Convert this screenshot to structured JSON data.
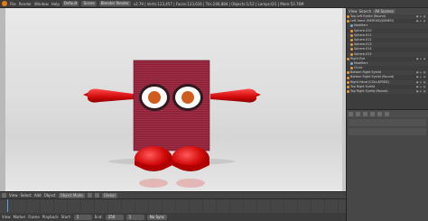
{
  "topbar": {
    "menus": [
      "File",
      "Render",
      "Window",
      "Help"
    ],
    "layout": "Default",
    "scene": "Scene",
    "engine": "Blender Render",
    "stats": "v2.79 | Verts:123,457 | Faces:123,616 | Tris:246,884 | Objects:1/12 | Lamps:0/1 | Mem:53.76M"
  },
  "viewport_header": {
    "items": [
      "View",
      "Select",
      "Add",
      "Object"
    ],
    "mode": "Object Mode",
    "pivot": "Global"
  },
  "timeline": {
    "items": [
      "View",
      "Marker",
      "Frame",
      "Playback"
    ],
    "start_label": "Start:",
    "start": "1",
    "end_label": "End:",
    "end": "250",
    "current": "1",
    "sync": "No Sync"
  },
  "outliner": {
    "view": "View",
    "search": "Search",
    "scope": "All Scenes",
    "rows": [
      {
        "label": "Top Left Eyelid (Round)"
      },
      {
        "label": "Left Hand (MERGED/JOINED)"
      },
      {
        "label": "Modifiers"
      },
      {
        "label": "Sphere.010"
      },
      {
        "label": "Sphere.011"
      },
      {
        "label": "Sphere.012"
      },
      {
        "label": "Sphere.013"
      },
      {
        "label": "Sphere.014"
      },
      {
        "label": "Sphere.015"
      },
      {
        "label": "Right Eye"
      },
      {
        "label": "Modifiers"
      },
      {
        "label": "Circle"
      },
      {
        "label": "Bottom Right Eyelid"
      },
      {
        "label": "Bottom Right Eyelid (Round)"
      },
      {
        "label": "Right Hand (COLLAPSED)"
      },
      {
        "label": "Top Right Eyelid"
      },
      {
        "label": "Top Right Eyelid (Round)"
      }
    ]
  },
  "colors": {
    "accent": "#e87d0d",
    "body": "#8c1c34",
    "limb": "#d60d0d",
    "eye_white": "#ffffff",
    "iris": "#d0601c"
  }
}
